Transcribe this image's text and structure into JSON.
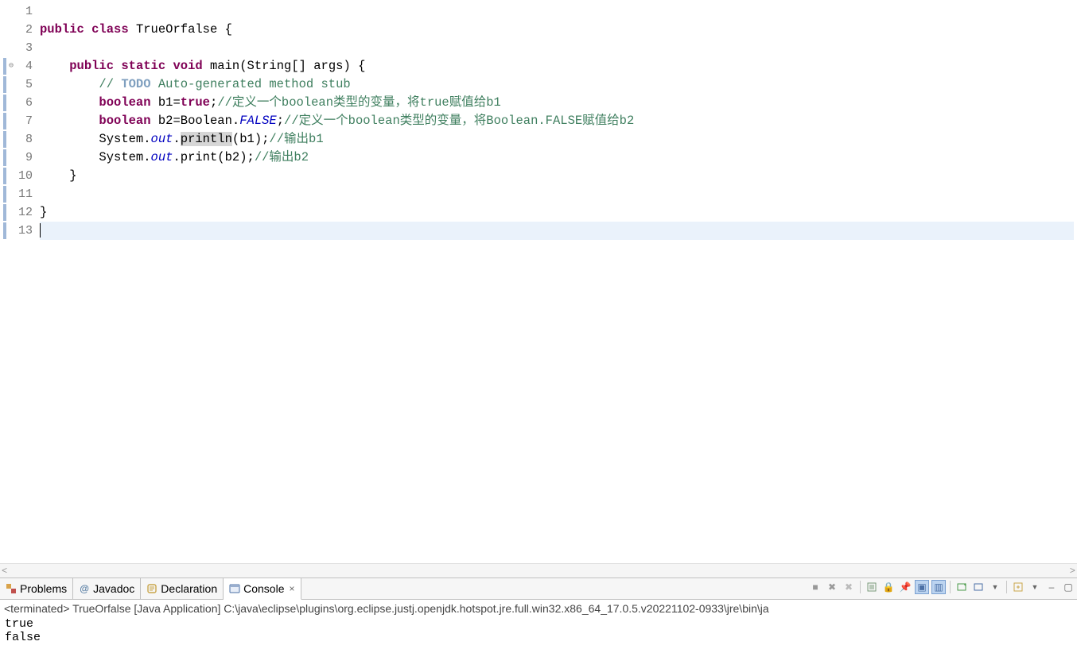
{
  "editor": {
    "line_count": 13,
    "current_line": 13,
    "markers": {
      "change_bar": [
        4,
        5,
        6,
        7,
        8,
        9,
        10,
        11,
        12,
        13
      ],
      "fold_at": 4
    },
    "code": {
      "1": "",
      "2": {
        "t": [
          "public",
          " ",
          "class",
          " ",
          "TrueOrfalse",
          " ",
          "{"
        ],
        "c": [
          "kw",
          "",
          "kw",
          "",
          "id",
          "",
          "punc"
        ]
      },
      "3": "",
      "4": {
        "t": [
          "    ",
          "public",
          " ",
          "static",
          " ",
          "void",
          " ",
          "main",
          "(",
          "String",
          "[] ",
          "args",
          ") {"
        ],
        "c": [
          "",
          "kw",
          "",
          "kw",
          "",
          "kw",
          "",
          "mtd",
          "punc",
          "id",
          "punc",
          "id",
          "punc"
        ]
      },
      "5": {
        "t": [
          "        ",
          "// ",
          "TODO",
          " Auto-generated method stub"
        ],
        "c": [
          "",
          "cmt",
          "todo",
          "cmt"
        ]
      },
      "6": {
        "t": [
          "        ",
          "boolean",
          " ",
          "b1",
          "=",
          "true",
          ";",
          "//定义一个boolean类型的变量，将true赋值给b1"
        ],
        "c": [
          "",
          "kw",
          "",
          "id",
          "punc",
          "kw",
          "punc",
          "cmt"
        ]
      },
      "7": {
        "t": [
          "        ",
          "boolean",
          " ",
          "b2",
          "=",
          "Boolean",
          ".",
          "FALSE",
          ";",
          "//定义一个boolean类型的变量，将Boolean.FALSE赋值给b2"
        ],
        "c": [
          "",
          "kw",
          "",
          "id",
          "punc",
          "id",
          "punc",
          "fld",
          "punc",
          "cmt"
        ]
      },
      "8": {
        "t": [
          "        ",
          "System",
          ".",
          "out",
          ".",
          "println",
          "(",
          "b1",
          ");",
          "//输出b1"
        ],
        "c": [
          "",
          "id",
          "punc",
          "fld",
          "punc",
          "mtd hl",
          "punc",
          "id",
          "punc",
          "cmt"
        ]
      },
      "9": {
        "t": [
          "        ",
          "System",
          ".",
          "out",
          ".",
          "print",
          "(",
          "b2",
          ");",
          "//输出b2"
        ],
        "c": [
          "",
          "id",
          "punc",
          "fld",
          "punc",
          "mtd",
          "punc",
          "id",
          "punc",
          "cmt"
        ]
      },
      "10": {
        "t": [
          "    }"
        ],
        "c": [
          "punc"
        ]
      },
      "11": "",
      "12": {
        "t": [
          "}"
        ],
        "c": [
          "punc"
        ]
      },
      "13": ""
    }
  },
  "tabs": {
    "problems": "Problems",
    "javadoc": "Javadoc",
    "declaration": "Declaration",
    "console": "Console"
  },
  "console": {
    "header": "<terminated> TrueOrfalse [Java Application] C:\\java\\eclipse\\plugins\\org.eclipse.justj.openjdk.hotspot.jre.full.win32.x86_64_17.0.5.v20221102-0933\\jre\\bin\\ja",
    "line1": "true",
    "line2": "false"
  },
  "icons": {
    "problems": "⚠",
    "javadoc": "@",
    "declaration": "🔍",
    "console": "▢",
    "close": "×",
    "btn_stop": "■",
    "btn_remove": "✖",
    "btn_remove_all": "✖",
    "btn_clear": "▤",
    "btn_lock": "🔒",
    "btn_pin": "📌",
    "btn_display": "▣",
    "btn_console_out": "▥",
    "btn_new": "▭",
    "btn_min": "–",
    "btn_max": "▢"
  }
}
